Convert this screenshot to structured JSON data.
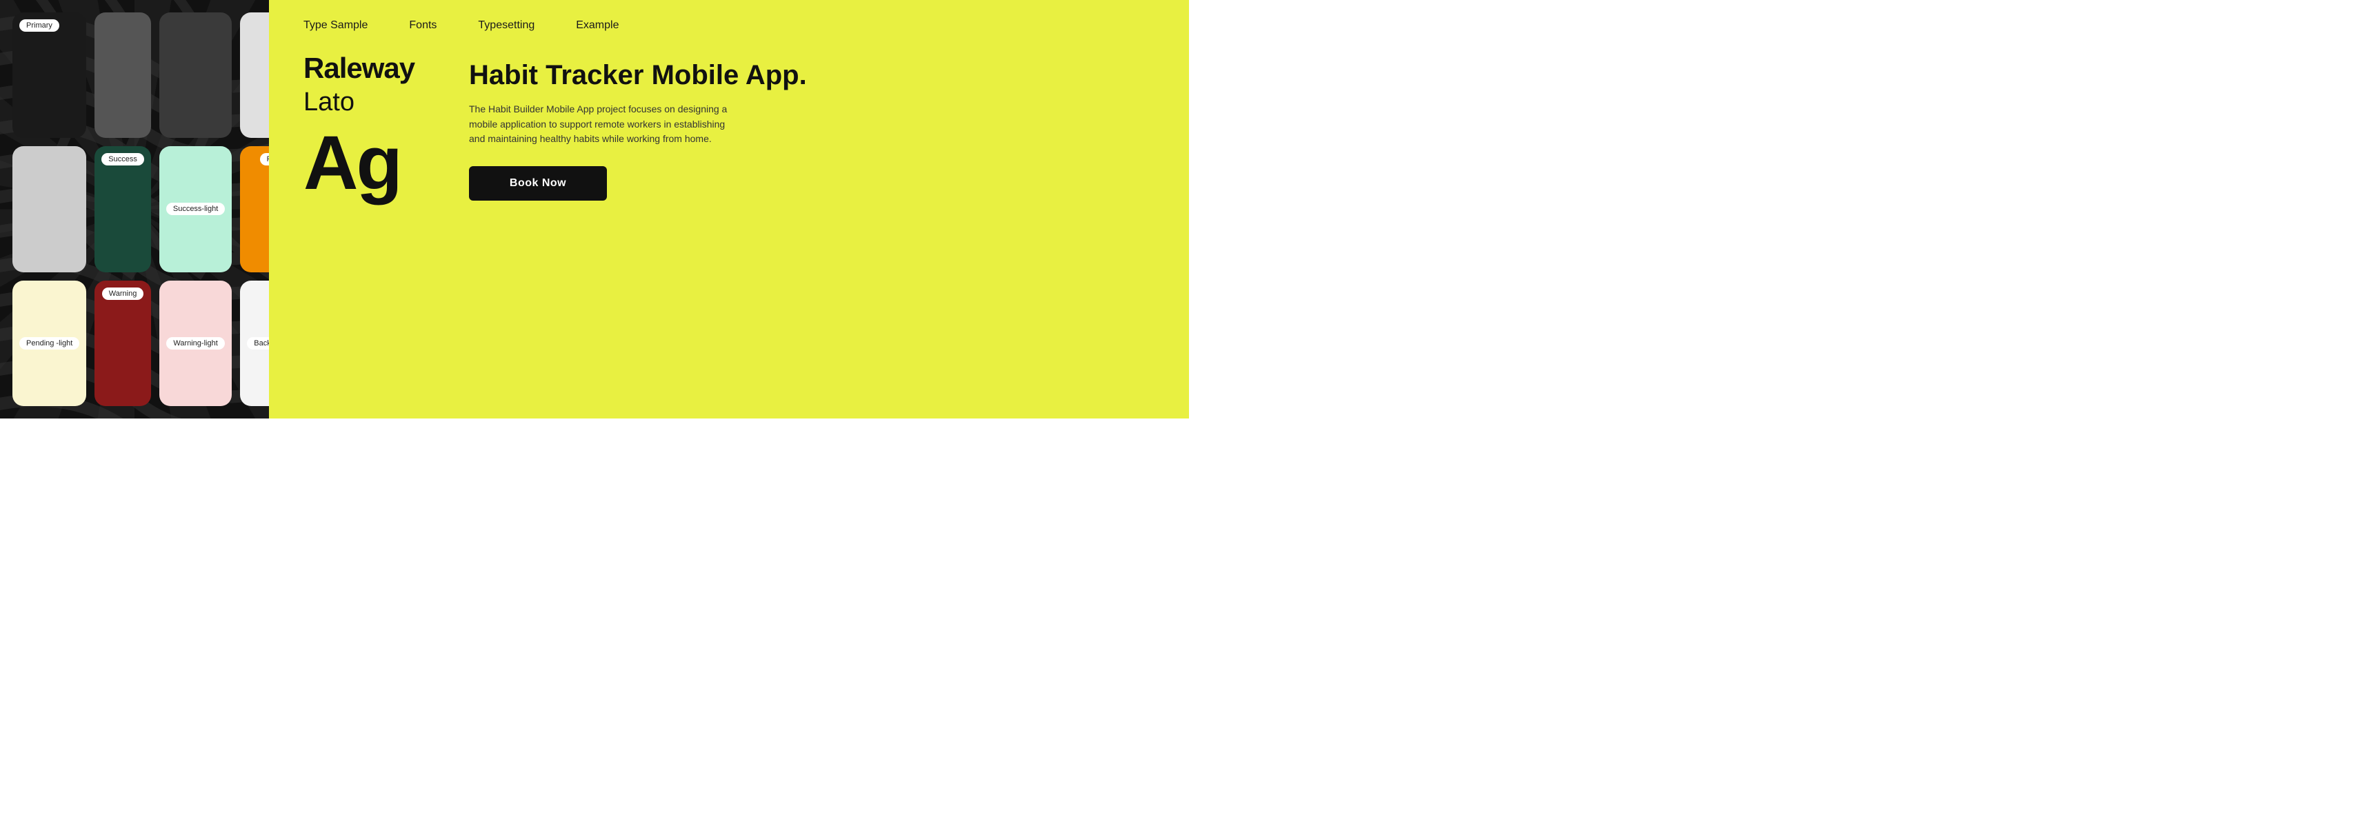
{
  "left_panel": {
    "swatches": [
      {
        "id": "primary",
        "label": "Primary",
        "color": "#1a1a1a",
        "show_label": true,
        "label_visible": true
      },
      {
        "id": "dark-gray",
        "label": "",
        "color": "#555555",
        "show_label": false
      },
      {
        "id": "medium-gray",
        "label": "",
        "color": "#3a3a3a",
        "show_label": false
      },
      {
        "id": "light-gray-top",
        "label": "",
        "color": "#e0e0e0",
        "show_label": false
      },
      {
        "id": "light-gray-mid",
        "label": "",
        "color": "#cccccc",
        "show_label": false
      },
      {
        "id": "success",
        "label": "Success",
        "color": "#1a4a3a",
        "show_label": true
      },
      {
        "id": "success-light",
        "label": "Success-light",
        "color": "#b8f0d8",
        "show_label": true
      },
      {
        "id": "pending",
        "label": "Pending",
        "color": "#f08c00",
        "show_label": true
      },
      {
        "id": "pending-light",
        "label": "Pending -light",
        "color": "#faf5d0",
        "show_label": true
      },
      {
        "id": "warning",
        "label": "Warning",
        "color": "#8b1a1a",
        "show_label": true
      },
      {
        "id": "warning-light",
        "label": "Warning-light",
        "color": "#f8d8d8",
        "show_label": true
      },
      {
        "id": "background",
        "label": "Background",
        "color": "#f4f4f4",
        "show_label": true
      }
    ]
  },
  "nav": {
    "items": [
      {
        "id": "type-sample",
        "label": "Type Sample"
      },
      {
        "id": "fonts",
        "label": "Fonts"
      },
      {
        "id": "typesetting",
        "label": "Typesetting"
      },
      {
        "id": "example",
        "label": "Example"
      }
    ]
  },
  "typography": {
    "font_bold": "Raleway",
    "font_light": "Lato",
    "sample_chars": "Ag"
  },
  "app_preview": {
    "title": "Habit Tracker Mobile App.",
    "description": "The Habit Builder Mobile App project focuses on designing a mobile application to support remote workers in establishing and maintaining healthy habits while working from home.",
    "button_label": "Book Now"
  },
  "colors": {
    "background_yellow": "#E8F041",
    "panel_dark": "#111111",
    "text_dark": "#111111",
    "button_bg": "#111111",
    "button_text": "#ffffff"
  }
}
